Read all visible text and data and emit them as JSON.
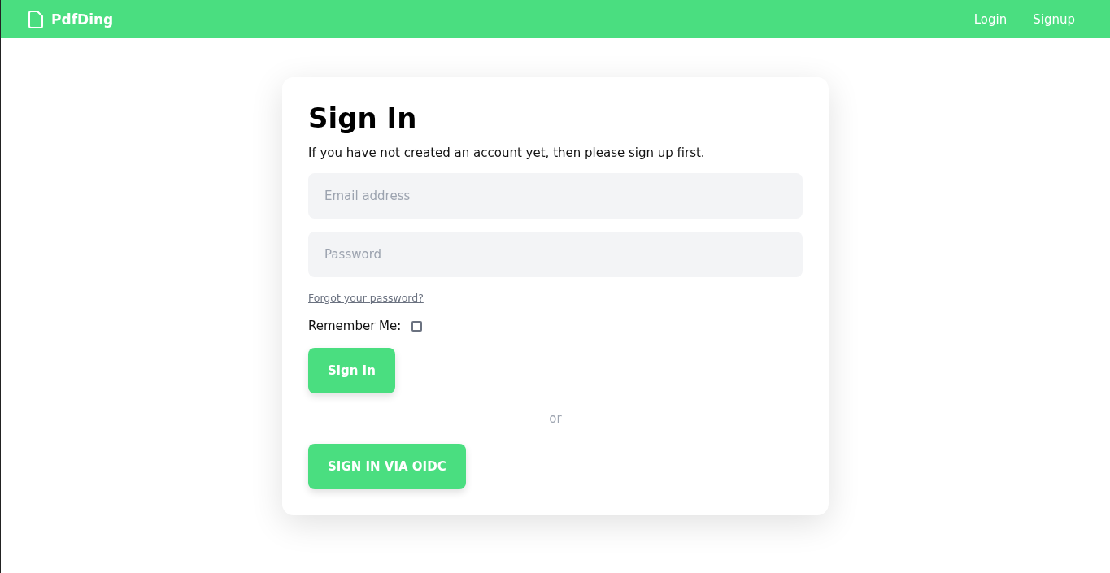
{
  "navbar": {
    "brand": "PdfDing",
    "links": [
      "Login",
      "Signup"
    ]
  },
  "card": {
    "title": "Sign In",
    "intro": {
      "before": "If you have not created an account yet, then please ",
      "link": "sign up",
      "after": " first."
    },
    "email": {
      "placeholder": "Email address"
    },
    "password": {
      "placeholder": "Password"
    },
    "forgot": "Forgot your password?",
    "remember": {
      "label": "Remember Me:",
      "checked": false
    },
    "submit": "Sign In",
    "divider": "or",
    "oidc": "SIGN IN VIA OIDC"
  }
}
